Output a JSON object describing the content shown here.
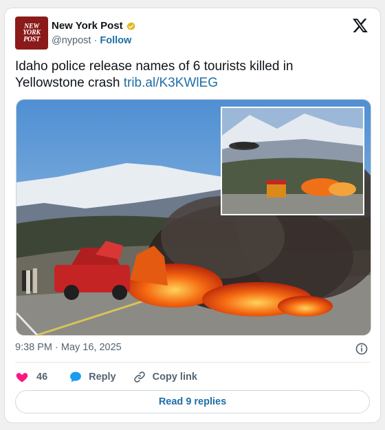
{
  "author": {
    "name": "New York Post",
    "handle": "@nypost",
    "separator": "·",
    "follow_label": "Follow",
    "logo_lines": [
      "NEW",
      "YORK",
      "POST"
    ]
  },
  "tweet": {
    "text": "Idaho police release names of 6 tourists killed in Yellowstone crash",
    "link": "trib.al/K3KWlEG",
    "timestamp": "9:38 PM · May 16, 2025"
  },
  "actions": {
    "like_count": "46",
    "reply_label": "Reply",
    "copy_label": "Copy link"
  },
  "read_replies": "Read 9 replies",
  "colors": {
    "link": "#1d6fa5",
    "like": "#f91880",
    "reply_icon": "#1d9bf0",
    "verified": "#e2b719",
    "logo_bg": "#8b1a1a"
  },
  "icons": {
    "verified": "verified-badge-icon",
    "platform": "x-logo-icon",
    "info": "info-icon",
    "like": "heart-icon",
    "reply": "reply-bubble-icon",
    "copy": "link-icon"
  }
}
